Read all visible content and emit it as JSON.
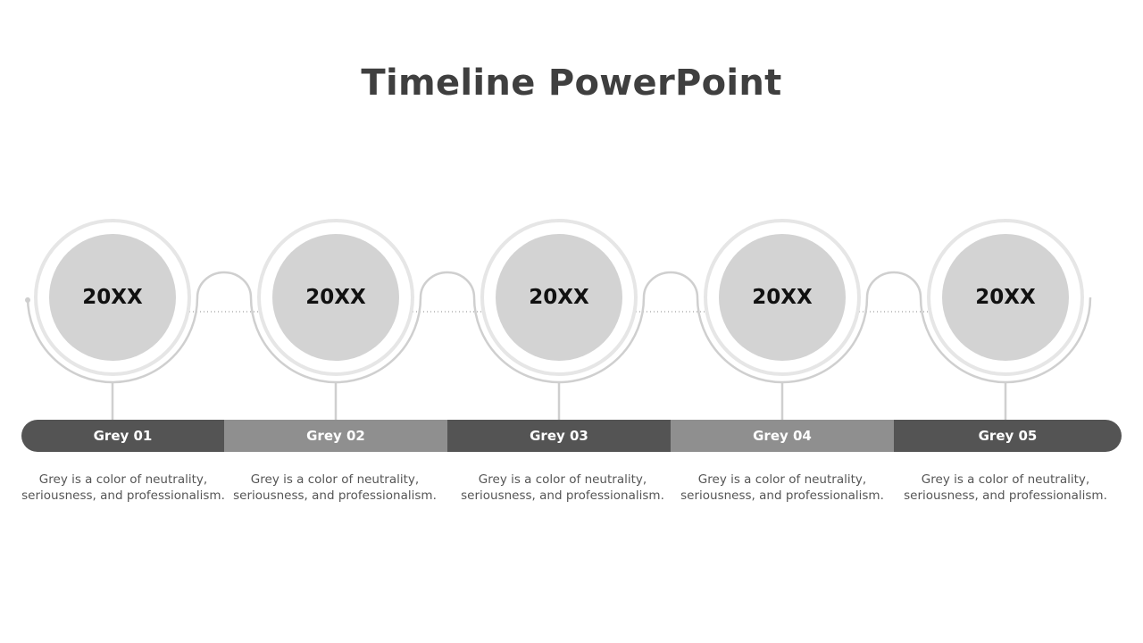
{
  "slide": {
    "title": "Timeline PowerPoint"
  },
  "colors": {
    "title": "#3f3f3f",
    "bar_dark": "#545454",
    "bar_light": "#8f8f8f",
    "circle_fill": "#d3d3d3",
    "ring": "#e6e6e6",
    "line": "#cfcfcf",
    "desc_text": "#555555"
  },
  "milestones": [
    {
      "year": "20XX",
      "label": "Grey 01",
      "tone": "dark",
      "description": "Grey is a color of neutrality, seriousness, and professionalism."
    },
    {
      "year": "20XX",
      "label": "Grey 02",
      "tone": "light",
      "description": "Grey is a color of neutrality, seriousness, and professionalism."
    },
    {
      "year": "20XX",
      "label": "Grey 03",
      "tone": "dark",
      "description": "Grey is a color of neutrality, seriousness, and professionalism."
    },
    {
      "year": "20XX",
      "label": "Grey 04",
      "tone": "light",
      "description": "Grey is a color of neutrality, seriousness, and professionalism."
    },
    {
      "year": "20XX",
      "label": "Grey 05",
      "tone": "dark",
      "description": "Grey is a color of neutrality, seriousness, and professionalism."
    }
  ]
}
